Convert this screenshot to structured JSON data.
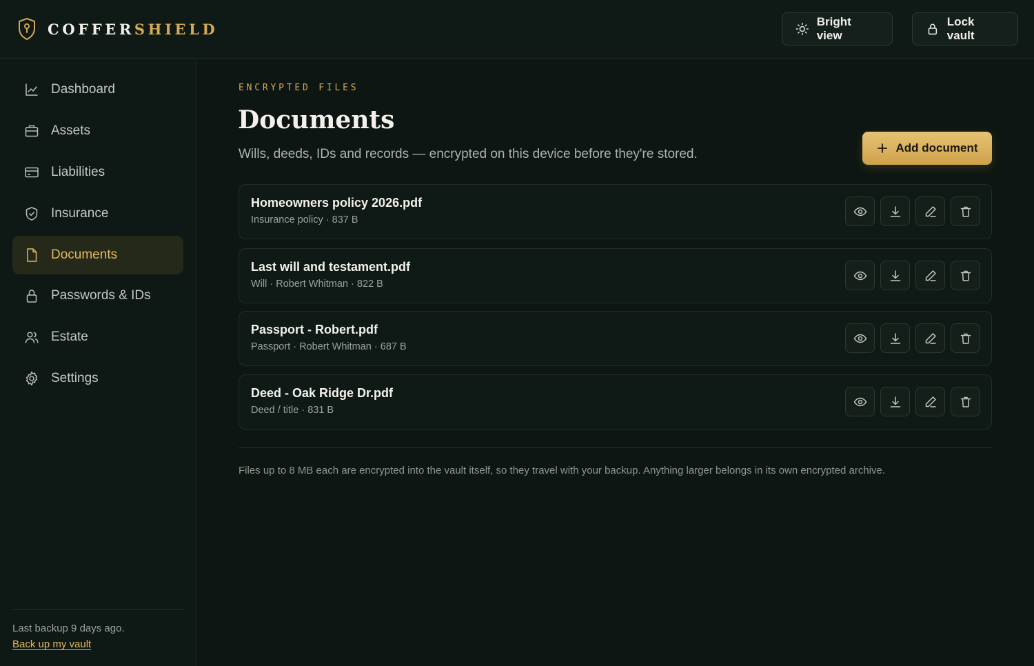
{
  "brand": {
    "name_part1": "COFFER",
    "name_part2": "SHIELD"
  },
  "header": {
    "bright_view_label": "Bright view",
    "lock_vault_label": "Lock vault"
  },
  "sidebar": {
    "items": [
      {
        "label": "Dashboard",
        "icon": "chart-line-icon",
        "active": false
      },
      {
        "label": "Assets",
        "icon": "briefcase-icon",
        "active": false
      },
      {
        "label": "Liabilities",
        "icon": "credit-card-icon",
        "active": false
      },
      {
        "label": "Insurance",
        "icon": "shield-check-icon",
        "active": false
      },
      {
        "label": "Documents",
        "icon": "document-icon",
        "active": true
      },
      {
        "label": "Passwords & IDs",
        "icon": "lock-icon",
        "active": false
      },
      {
        "label": "Estate",
        "icon": "users-icon",
        "active": false
      },
      {
        "label": "Settings",
        "icon": "gear-icon",
        "active": false
      }
    ],
    "backup_status": "Last backup 9 days ago.",
    "backup_link": "Back up my vault"
  },
  "main": {
    "eyebrow": "ENCRYPTED FILES",
    "title": "Documents",
    "subtitle": "Wills, deeds, IDs and records — encrypted on this device before they're stored.",
    "add_button_label": "Add document",
    "documents": [
      {
        "name": "Homeowners policy 2026.pdf",
        "meta": "Insurance policy · 837 B"
      },
      {
        "name": "Last will and testament.pdf",
        "meta": "Will · Robert Whitman · 822 B"
      },
      {
        "name": "Passport - Robert.pdf",
        "meta": "Passport · Robert Whitman · 687 B"
      },
      {
        "name": "Deed - Oak Ridge Dr.pdf",
        "meta": "Deed / title · 831 B"
      }
    ],
    "footnote": "Files up to 8 MB each are encrypted into the vault itself, so they travel with your backup. Anything larger belongs in its own encrypted archive."
  },
  "colors": {
    "accent": "#d4aa55",
    "background": "#0d1612",
    "panel": "#0f1a16",
    "active_nav": "#252919"
  }
}
